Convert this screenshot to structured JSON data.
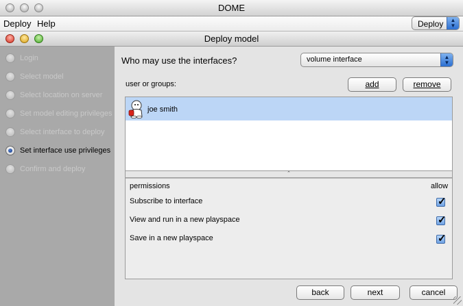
{
  "window": {
    "title": "DOME"
  },
  "menubar": {
    "items": [
      "Deploy",
      "Help"
    ],
    "popup_value": "Deploy"
  },
  "dialog": {
    "title": "Deploy model"
  },
  "steps": [
    {
      "label": "Login",
      "active": false
    },
    {
      "label": "Select model",
      "active": false
    },
    {
      "label": "Select location on server",
      "active": false
    },
    {
      "label": "Set model editing privileges",
      "active": false
    },
    {
      "label": "Select interface to deploy",
      "active": false
    },
    {
      "label": "Set interface use privileges",
      "active": true
    },
    {
      "label": "Confirm and deploy",
      "active": false
    }
  ],
  "main": {
    "question": "Who may use the interfaces?",
    "interface_selected": "volume interface",
    "users_label": "user or groups:",
    "add_label": "add",
    "remove_label": "remove",
    "users": [
      {
        "name": "joe smith",
        "icon": "user-figure-icon"
      }
    ],
    "permissions_header": "permissions",
    "allow_header": "allow",
    "permissions": [
      {
        "label": "Subscribe to interface",
        "allowed": true
      },
      {
        "label": "View and run in a new playspace",
        "allowed": true
      },
      {
        "label": "Save in a new playspace",
        "allowed": true
      }
    ]
  },
  "footer": {
    "back_label": "back",
    "next_label": "next",
    "cancel_label": "cancel"
  }
}
